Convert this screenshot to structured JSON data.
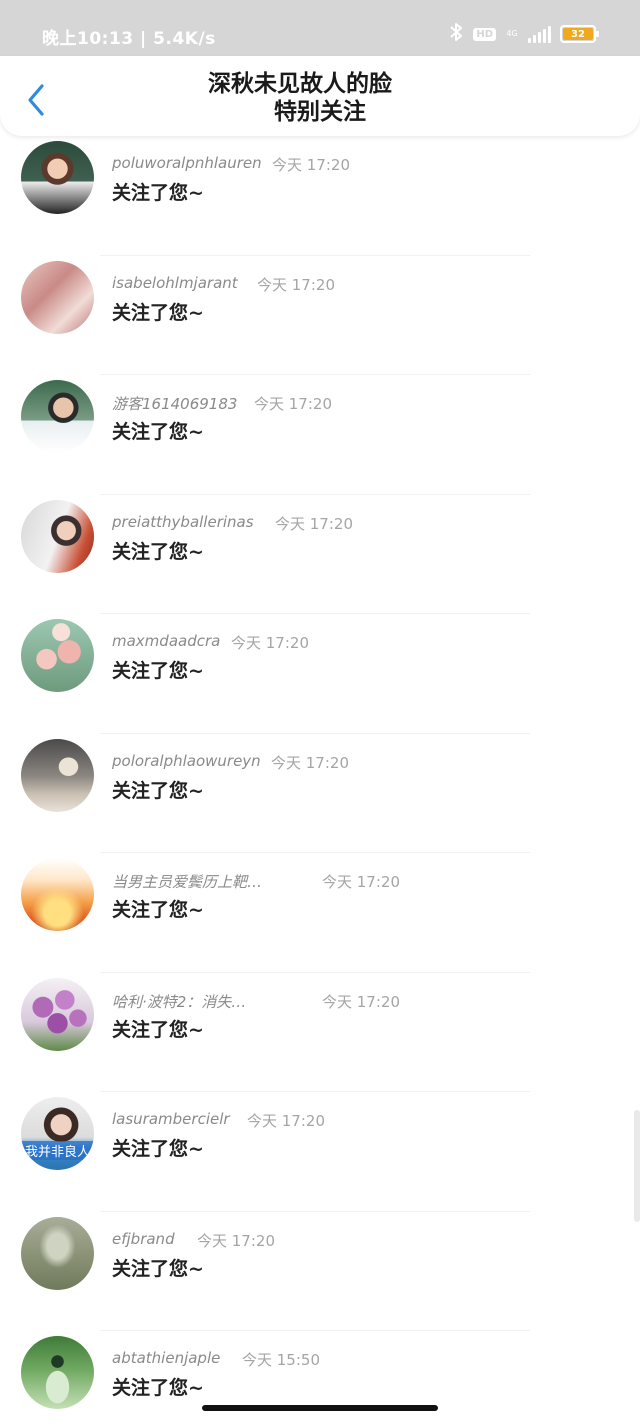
{
  "status_bar": {
    "time_speed": "晚上10:13 | 5.4K/s",
    "hd": "HD",
    "network": "4G",
    "battery": "32",
    "icons": [
      "bluetooth-icon",
      "hd-icon",
      "signal-icon",
      "battery-icon"
    ]
  },
  "header": {
    "title": "深秋未见故人的脸",
    "subtitle": "特别关注",
    "back_icon": "chevron-left-icon",
    "accent_color": "#2f8bde"
  },
  "notifications": [
    {
      "username": "poluworalpnhlauren",
      "time": "今天 17:20",
      "message": "关注了您~",
      "avatar": "boy-photo"
    },
    {
      "username": "isabelohlmjarant",
      "time": "今天 17:20",
      "message": "关注了您~",
      "avatar": "pink-collage"
    },
    {
      "username": "游客1614069183",
      "time": "今天 17:20",
      "message": "关注了您~",
      "avatar": "man-portrait"
    },
    {
      "username": "preiatthyballerinas",
      "time": "今天 17:20",
      "message": "关注了您~",
      "avatar": "boy-selfie"
    },
    {
      "username": "maxmdaadcra",
      "time": "今天 17:20",
      "message": "关注了您~",
      "avatar": "roses"
    },
    {
      "username": "poloralphlaowureyn",
      "time": "今天 17:20",
      "message": "关注了您~",
      "avatar": "robot-toy"
    },
    {
      "username": "当男主员爱鬓历上靶…",
      "time": "今天 17:20",
      "message": "关注了您~",
      "avatar": "runner-sunset"
    },
    {
      "username": "哈利·波特2：消失…",
      "time": "今天 17:20",
      "message": "关注了您~",
      "avatar": "purple-tulips"
    },
    {
      "username": "lasurambercielr",
      "time": "今天 17:20",
      "message": "关注了您~",
      "avatar": "girl-caption",
      "avatar_text": "我并非良人"
    },
    {
      "username": "efjbrand",
      "time": "今天 17:20",
      "message": "关注了您~",
      "avatar": "grass-figure"
    },
    {
      "username": "abtathienjaple",
      "time": "今天 15:50",
      "message": "关注了您~",
      "avatar": "clover-jar"
    }
  ]
}
